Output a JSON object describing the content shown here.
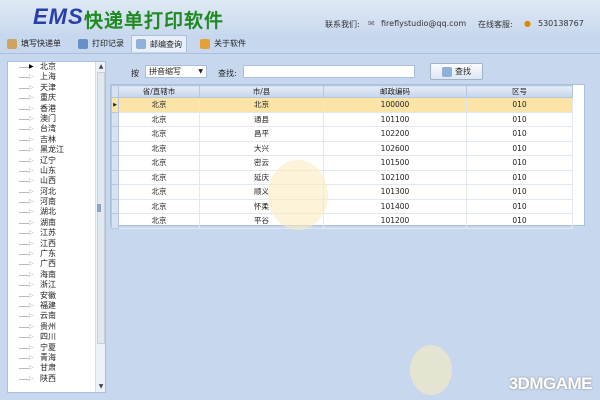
{
  "header": {
    "logo": "EMS",
    "title": "快递单打印软件",
    "contact_label": "联系我们:",
    "email": "fireflystudio@qq.com",
    "support_label": "在线客服:",
    "qq": "530138767"
  },
  "tabs": [
    {
      "label": "填写快递单"
    },
    {
      "label": "打印记录"
    },
    {
      "label": "邮编查询"
    },
    {
      "label": "关于软件"
    }
  ],
  "tree": [
    "北京",
    "上海",
    "天津",
    "重庆",
    "香港",
    "澳门",
    "台湾",
    "吉林",
    "黑龙江",
    "辽宁",
    "山东",
    "山西",
    "河北",
    "河南",
    "湖北",
    "湖南",
    "江苏",
    "江西",
    "广东",
    "广西",
    "海南",
    "浙江",
    "安徽",
    "福建",
    "云南",
    "贵州",
    "四川",
    "宁夏",
    "青海",
    "甘肃",
    "陕西"
  ],
  "search": {
    "by_label": "按",
    "mode": "拼音缩写",
    "find_label": "查找:",
    "query": "",
    "button": "查找"
  },
  "grid": {
    "headers": [
      "省/直辖市",
      "市/县",
      "邮政编码",
      "区号"
    ],
    "rows": [
      [
        "北京",
        "北京",
        "100000",
        "010"
      ],
      [
        "北京",
        "通县",
        "101100",
        "010"
      ],
      [
        "北京",
        "昌平",
        "102200",
        "010"
      ],
      [
        "北京",
        "大兴",
        "102600",
        "010"
      ],
      [
        "北京",
        "密云",
        "101500",
        "010"
      ],
      [
        "北京",
        "延庆",
        "102100",
        "010"
      ],
      [
        "北京",
        "顺义",
        "101300",
        "010"
      ],
      [
        "北京",
        "怀柔",
        "101400",
        "010"
      ],
      [
        "北京",
        "平谷",
        "101200",
        "010"
      ]
    ]
  },
  "watermark": "3DMGAME"
}
